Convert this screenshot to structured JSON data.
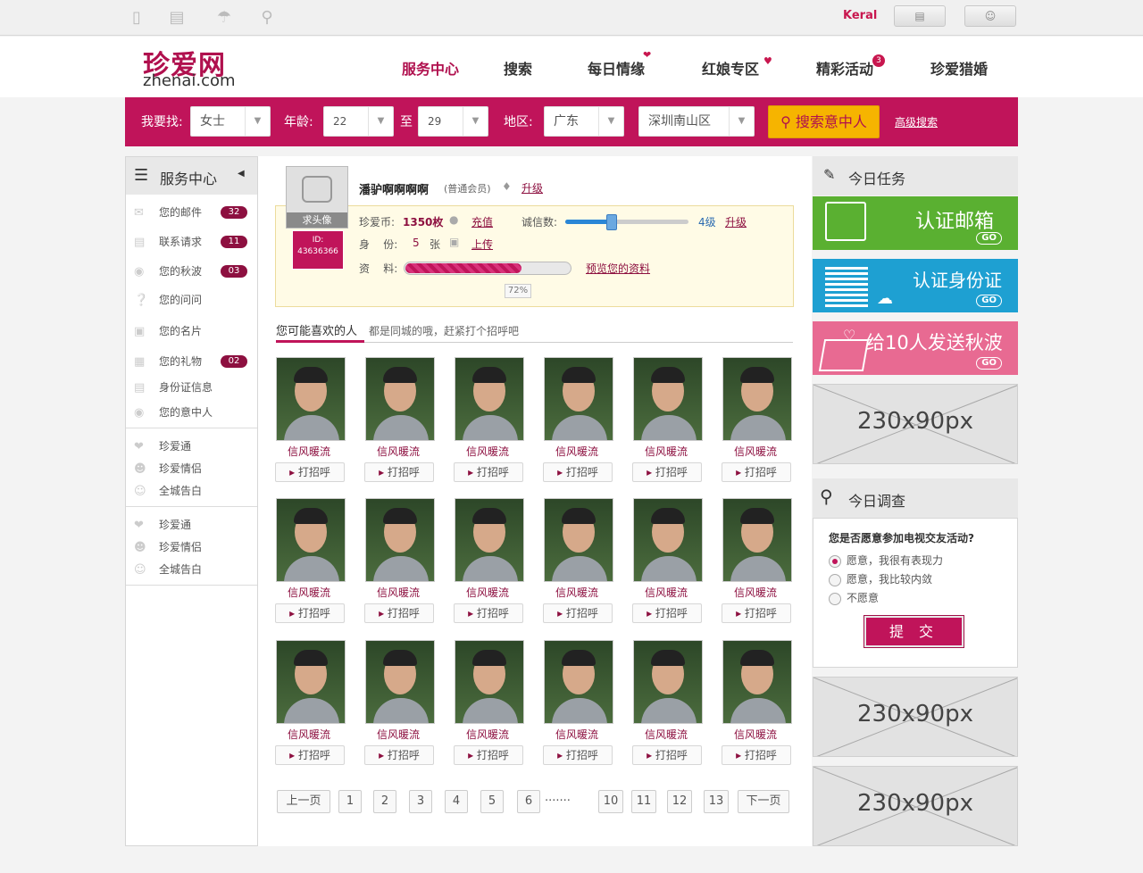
{
  "topbar": {
    "user": "Keral",
    "icons": [
      "phone-icon",
      "document-icon",
      "umbrella-icon",
      "location-pin-icon"
    ],
    "btn1": "message-icon",
    "btn2": "user-icon"
  },
  "logo": {
    "cn": "珍爱网",
    "en": "zhenai.com"
  },
  "nav": {
    "items": [
      "服务中心",
      "搜索",
      "每日情缘",
      "红娘专区",
      "精彩活动",
      "珍爱猎婚"
    ],
    "badge": "3"
  },
  "search": {
    "find_label": "我要找:",
    "gender": "女士",
    "age_label": "年龄:",
    "age_min": "22",
    "to": "至",
    "age_max": "29",
    "region_label": "地区:",
    "province": "广东",
    "city": "深圳南山区",
    "button": "搜索意中人",
    "advanced": "高级搜索"
  },
  "sidebar": {
    "title": "服务中心",
    "items": [
      {
        "label": "您的邮件",
        "badge": "32"
      },
      {
        "label": "联系请求",
        "badge": "11"
      },
      {
        "label": "您的秋波",
        "badge": "03"
      },
      {
        "label": "您的问问",
        "badge": ""
      },
      {
        "label": "您的名片",
        "badge": ""
      },
      {
        "label": "您的礼物",
        "badge": "02"
      },
      {
        "label": "身份证信息",
        "badge": ""
      },
      {
        "label": "您的意中人",
        "badge": ""
      }
    ],
    "group2": [
      "珍爱通",
      "珍爱情侣",
      "全城告白"
    ],
    "group3": [
      "珍爱通",
      "珍爱情侣",
      "全城告白"
    ]
  },
  "profile": {
    "avatar_caption": "求头像",
    "id_label": "ID:",
    "id_value": "43636366",
    "name": "潘驴啊啊啊啊",
    "level": "(普通会员)",
    "upgrade": "升级",
    "coins_label": "珍爱币:",
    "coins": "1350枚",
    "recharge": "充值",
    "credit_label": "诚信数:",
    "credit_level": "4级",
    "credit_upgrade": "升级",
    "identity_label": "身    份:",
    "identity_count": "5",
    "identity_unit": "张",
    "upload": "上传",
    "data_label": "资    料:",
    "progress": "72%",
    "preview": "预览您的资料"
  },
  "recommend": {
    "title": "您可能喜欢的人",
    "subtitle": "都是同城的哦，赶紧打个招呼吧",
    "name": "信风暖流",
    "greet": "打招呼"
  },
  "pagination": {
    "prev": "上一页",
    "next": "下一页",
    "pages": [
      "1",
      "2",
      "3",
      "4",
      "5",
      "6",
      "10",
      "11",
      "12",
      "13"
    ],
    "ellipsis": "·······"
  },
  "right": {
    "tasks_title": "今日任务",
    "tasks": [
      {
        "label": "认证邮箱",
        "color": "#5ab031"
      },
      {
        "label": "认证身份证",
        "color": "#1ea0d2"
      },
      {
        "label": "给10人发送秋波",
        "color": "#e86a92"
      }
    ],
    "go": "GO",
    "ad_label": "230x90px",
    "survey_title": "今日调查",
    "survey_q": "您是否愿意参加电视交友活动?",
    "options": [
      "愿意，我很有表现力",
      "愿意，我比较内敛",
      "不愿意"
    ],
    "submit": "提 交"
  }
}
